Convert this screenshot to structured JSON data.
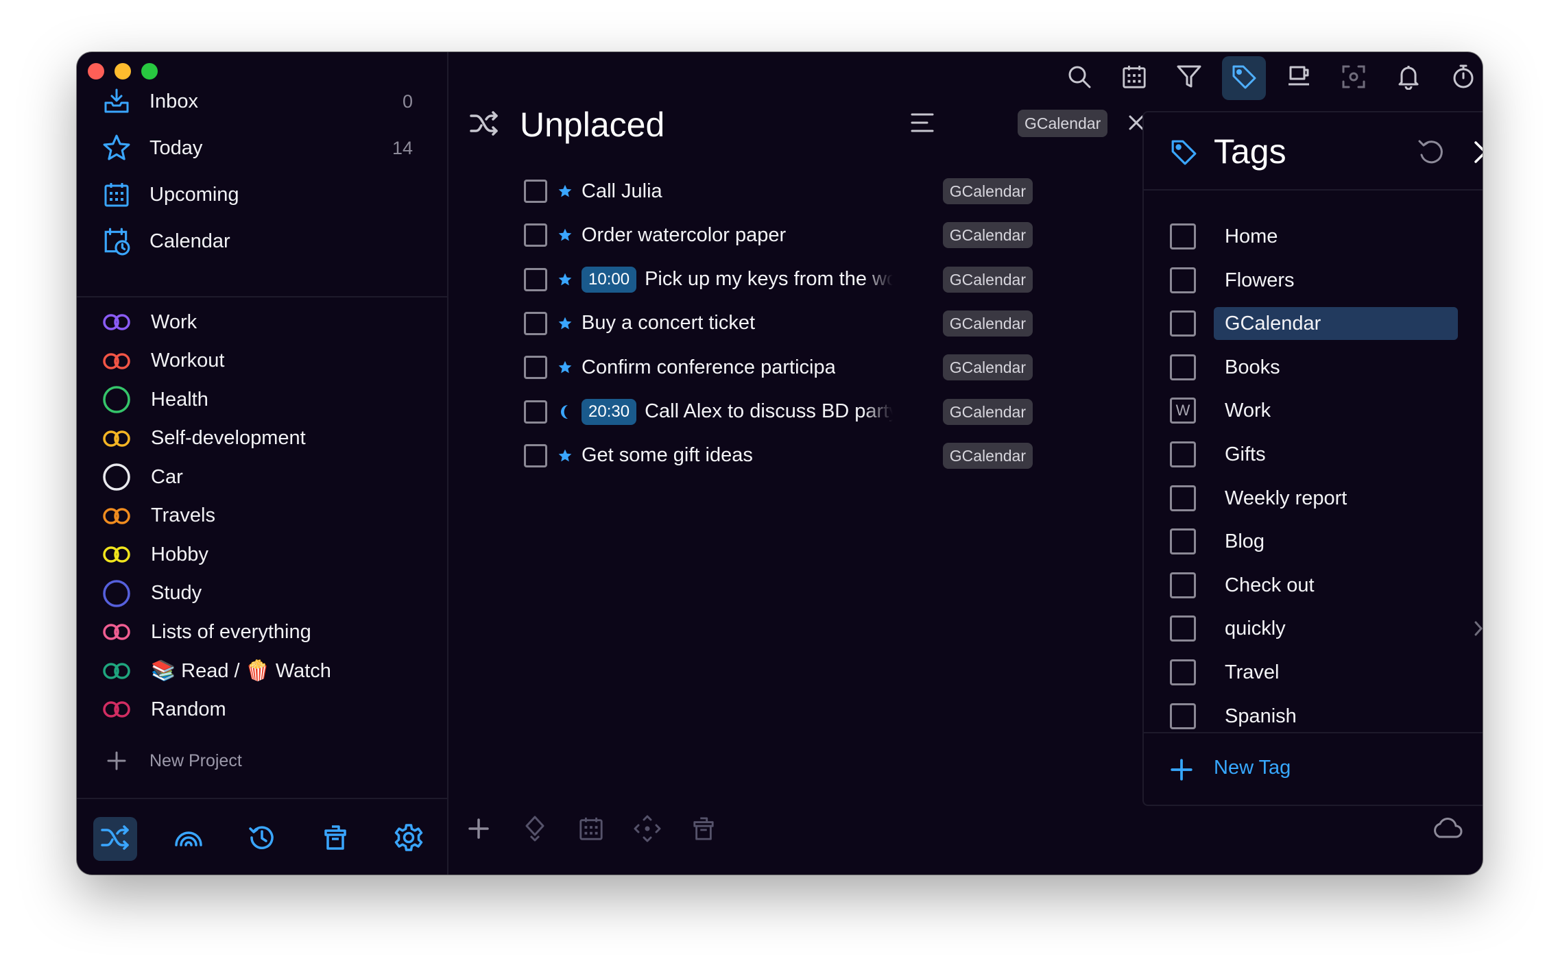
{
  "sidebar": {
    "nav": [
      {
        "label": "Inbox",
        "count": "0",
        "icon": "inbox-icon"
      },
      {
        "label": "Today",
        "count": "14",
        "icon": "star-icon"
      },
      {
        "label": "Upcoming",
        "count": "",
        "icon": "calendar-grid-icon"
      },
      {
        "label": "Calendar",
        "count": "",
        "icon": "calendar-clock-icon"
      }
    ],
    "projects": [
      {
        "label": "Work",
        "color": "#8b5cf6",
        "shape": "rings"
      },
      {
        "label": "Workout",
        "color": "#f25546",
        "shape": "rings"
      },
      {
        "label": "Health",
        "color": "#35c46a",
        "shape": "circle"
      },
      {
        "label": "Self-development",
        "color": "#f5b524",
        "shape": "rings"
      },
      {
        "label": "Car",
        "color": "#e9e9ee",
        "shape": "circle"
      },
      {
        "label": "Travels",
        "color": "#f08c1f",
        "shape": "rings"
      },
      {
        "label": "Hobby",
        "color": "#f1e51d",
        "shape": "rings"
      },
      {
        "label": "Study",
        "color": "#5660dc",
        "shape": "circle"
      },
      {
        "label": "Lists of everything",
        "color": "#f05e92",
        "shape": "rings"
      },
      {
        "label": "📚 Read / 🍿 Watch",
        "color": "#1fa57e",
        "shape": "rings"
      },
      {
        "label": "Random",
        "color": "#d22d62",
        "shape": "rings"
      }
    ],
    "new_project_label": "New Project",
    "bottom_icons": [
      "shuffle-icon",
      "rainbow-icon",
      "history-icon",
      "trash-icon",
      "gear-icon"
    ]
  },
  "toolbar": {
    "icons": [
      "search-icon",
      "calendar-icon",
      "filter-icon",
      "tag-icon",
      "coffee-icon",
      "focus-icon",
      "bell-icon",
      "timer-icon",
      "windows-icon"
    ],
    "active": "tag-icon"
  },
  "main": {
    "title": "Unplaced",
    "filter_chip": "GCalendar",
    "tasks": [
      {
        "text": "Call Julia",
        "mark": "star",
        "time": "",
        "tag": "GCalendar"
      },
      {
        "text": "Order watercolor paper",
        "mark": "star",
        "time": "",
        "tag": "GCalendar"
      },
      {
        "text": "Pick up my keys from the work",
        "mark": "star",
        "time": "10:00",
        "tag": "GCalendar"
      },
      {
        "text": "Buy a concert ticket",
        "mark": "star",
        "time": "",
        "tag": "GCalendar"
      },
      {
        "text": "Confirm conference participation",
        "mark": "star",
        "time": "",
        "tag": "GCalendar"
      },
      {
        "text": "Call Alex to discuss BD party",
        "mark": "moon",
        "time": "20:30",
        "tag": "GCalendar"
      },
      {
        "text": "Get some gift ideas",
        "mark": "star",
        "time": "",
        "tag": "GCalendar"
      }
    ],
    "bottom_icons": [
      "plus-icon",
      "priority-icon",
      "calendar-icon",
      "move-icon",
      "trash-icon"
    ]
  },
  "tags_panel": {
    "title": "Tags",
    "tags": [
      {
        "label": "Home",
        "box": "",
        "selected": false
      },
      {
        "label": "Flowers",
        "box": "",
        "selected": false
      },
      {
        "label": "GCalendar",
        "box": "",
        "selected": true
      },
      {
        "label": "Books",
        "box": "",
        "selected": false
      },
      {
        "label": "Work",
        "box": "W",
        "selected": false
      },
      {
        "label": "Gifts",
        "box": "",
        "selected": false
      },
      {
        "label": "Weekly report",
        "box": "",
        "selected": false
      },
      {
        "label": "Blog",
        "box": "",
        "selected": false
      },
      {
        "label": "Check out",
        "box": "",
        "selected": false
      },
      {
        "label": "quickly",
        "box": "",
        "selected": false
      },
      {
        "label": "Travel",
        "box": "",
        "selected": false
      },
      {
        "label": "Spanish",
        "box": "",
        "selected": false
      }
    ],
    "new_tag_label": "New Tag",
    "accent": "#37a8ff"
  }
}
